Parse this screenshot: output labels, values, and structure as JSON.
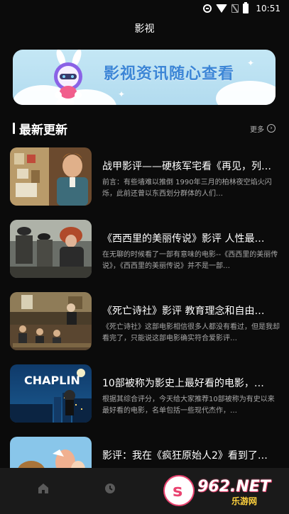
{
  "status": {
    "time": "10:51"
  },
  "header": {
    "title": "影视"
  },
  "banner": {
    "text": "影视资讯随心查看"
  },
  "section": {
    "title": "最新更新",
    "more_label": "更多"
  },
  "articles": [
    {
      "title": "战甲影评——硬核军宅看《再见，列…",
      "desc": "前言：有些墙难以推倒 1990年三月的柏林夜空焰火闪烁，此前还曾以东西划分群体的人们…"
    },
    {
      "title": "《西西里的美丽传说》影评 人性最…",
      "desc": "在无聊的时候看了一部有意味的电影--《西西里的美丽传说》，《西西里的美丽传说》并不是一部…"
    },
    {
      "title": "《死亡诗社》影评 教育理念和自由…",
      "desc": "《死亡诗社》这部电影相信很多人都没有看过，但是我却看完了，只能说这部电影确实符合爱影评…"
    },
    {
      "title": "10部被称为影史上最好看的电影，…",
      "desc": "根据其综合评分，今天给大家推荐10部被称为有史以来最好看的电影，名单包括一些现代杰作，…"
    },
    {
      "title": "影评：我在《疯狂原始人2》看到了…",
      "desc": ""
    }
  ],
  "thumb_labels": {
    "chaplin": "CHAPLIN"
  },
  "watermark": {
    "badge": "s",
    "number": "962.NET",
    "sub": "乐游网"
  },
  "colors": {
    "accent": "#3c86d6",
    "background": "#0b0b0b",
    "tabbar": "#1a1a1a",
    "watermark": "#e94370"
  },
  "icons": [
    "alert-circle-icon",
    "wifi-icon",
    "no-sim-icon",
    "battery-icon",
    "chevron-right-icon",
    "home-icon",
    "clock-icon"
  ]
}
